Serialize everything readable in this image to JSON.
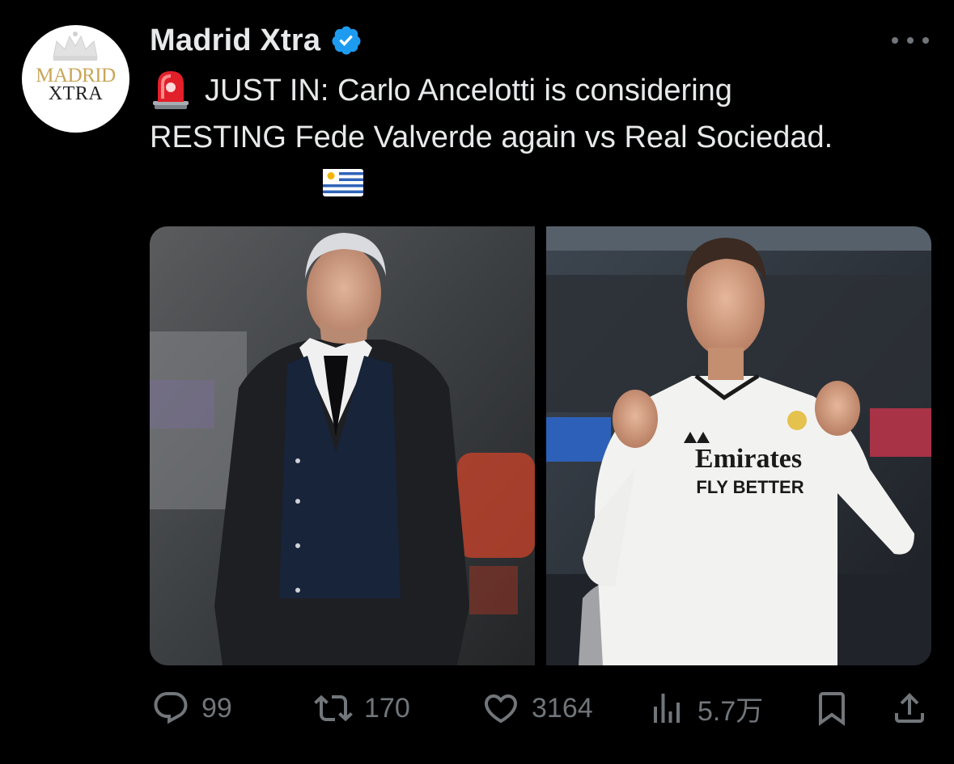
{
  "author": {
    "name": "Madrid Xtra",
    "avatar_line1": "MADRID",
    "avatar_line2": "XTRA",
    "verified": true
  },
  "tweet": {
    "line1": "JUST IN: Carlo Ancelotti is considering",
    "line2": "RESTING Fede Valverde again vs Real Sociedad.",
    "leading_emoji": "siren-emoji",
    "trailing_emoji": "uruguay-flag-emoji"
  },
  "media": {
    "left_image": "photo-carlo-ancelotti",
    "right_image": "photo-fede-valverde",
    "jersey_text_1": "Emirates",
    "jersey_text_2": "FLY BETTER"
  },
  "actions": {
    "replies": "99",
    "retweets": "170",
    "likes": "3164",
    "views": "5.7万"
  },
  "colors": {
    "background": "#000000",
    "text": "#e7e9ea",
    "muted": "#71767b",
    "verified": "#1d9bf0",
    "avatar_gold": "#c9a557"
  }
}
